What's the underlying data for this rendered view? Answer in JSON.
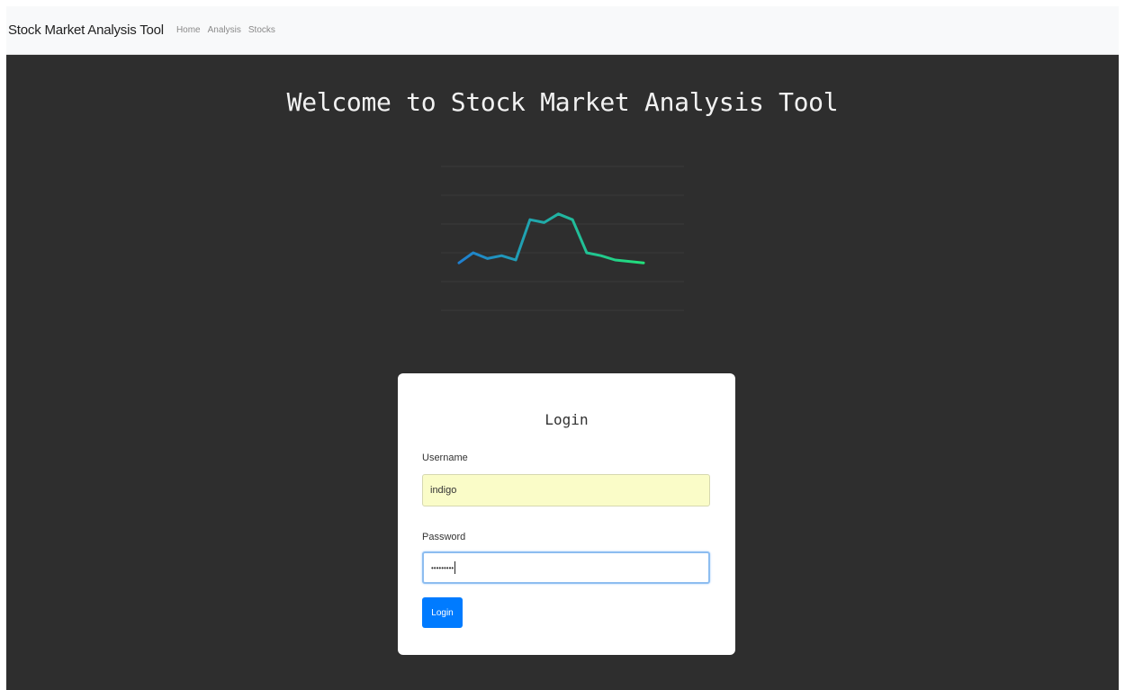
{
  "navbar": {
    "brand": "Stock Market Analysis Tool",
    "links": [
      "Home",
      "Analysis",
      "Stocks"
    ]
  },
  "hero": {
    "title": "Welcome to Stock Market Analysis Tool"
  },
  "chart_data": {
    "type": "line",
    "x": [
      1,
      2,
      3,
      4,
      5,
      6,
      7,
      8,
      9,
      10,
      11,
      12,
      13,
      14
    ],
    "values": [
      33,
      40,
      36,
      38,
      35,
      63,
      61,
      67,
      63,
      40,
      38,
      35,
      34,
      33
    ],
    "grid": true,
    "ylim": [
      0,
      100
    ],
    "colors": {
      "start": "#1f7fd0",
      "end": "#22e07a"
    }
  },
  "login": {
    "title": "Login",
    "username_label": "Username",
    "username_value": "indigo",
    "password_label": "Password",
    "password_value": "•••••••••",
    "button_label": "Login"
  },
  "colors": {
    "background": "#2e2e2e",
    "primary": "#007bff",
    "autofill": "#fafcc8"
  }
}
